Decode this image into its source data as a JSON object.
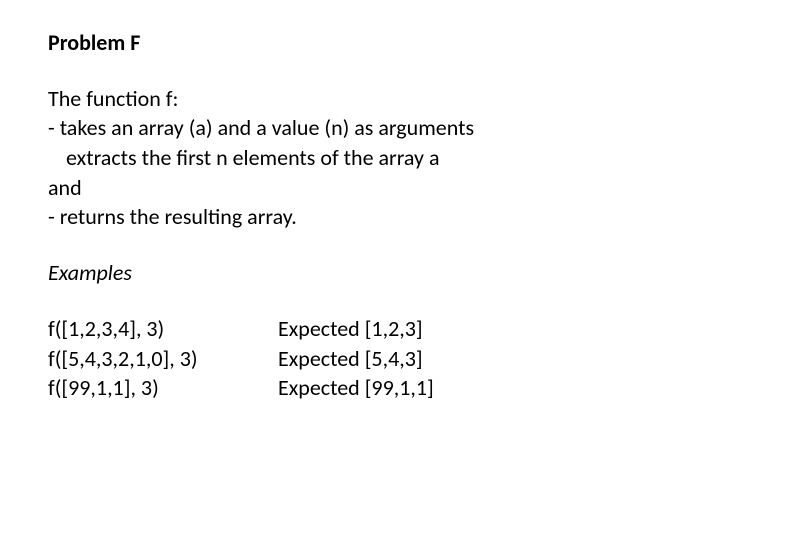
{
  "title": "Problem F",
  "description": {
    "line1": "The function f:",
    "line2": "- takes an array (a) and a value (n) as arguments",
    "line3": "extracts the first n elements of the array a",
    "line4": "and",
    "line5": "- returns the resulting array."
  },
  "examples_heading": "Examples",
  "examples": [
    {
      "call": "f([1,2,3,4], 3)",
      "expected": "Expected [1,2,3]"
    },
    {
      "call": "f([5,4,3,2,1,0], 3)",
      "expected": "Expected [5,4,3]"
    },
    {
      "call": "f([99,1,1], 3)",
      "expected": "Expected [99,1,1]"
    }
  ]
}
